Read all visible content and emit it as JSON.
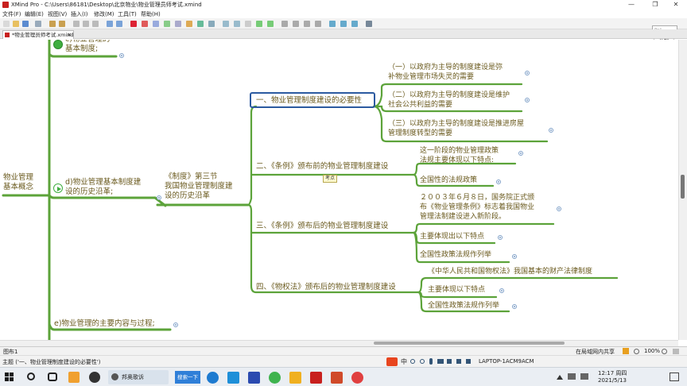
{
  "window": {
    "title": "XMind Pro - C:\\Users\\86181\\Desktop\\北京物业\\物业管理员师考试.xmind",
    "min": "—",
    "max": "❐",
    "close": "✕"
  },
  "menu": [
    "文件(F)",
    "编辑(E)",
    "视图(V)",
    "插入(I)",
    "修改(M)",
    "工具(T)",
    "帮助(H)"
  ],
  "tab": {
    "label": "*物业管理员师考试.xmind",
    "close": "✕"
  },
  "popup": {
    "hint": "Pol...",
    "button": "开始"
  },
  "mindmap": {
    "root": "物业管理\n基本概念",
    "top_topic": "c)物业管理的\n基本制度;",
    "d_topic": "d)物业管理基本制度建\n设的历史沿革;",
    "e_topic": "e)物业管理的主要内容与过程;",
    "section": "《制度》第三节\n我国物业管理制度建\n设的历史沿革",
    "marker": "考点",
    "branches": [
      {
        "label": "一、物业管理制度建设的必要性",
        "children": [
          "（一）以政府为主导的制度建设是弥\n补物业管理市场失灵的需要",
          "（二）以政府为主导的制度建设是维护\n社会公共利益的需要",
          "（三）以政府为主导的制度建设是推进房屋\n管理制度转型的需要"
        ]
      },
      {
        "label": "二、《条例》颁布前的物业管理制度建设",
        "children": [
          "这一阶段的物业管理政策\n法规主要体现以下特点:",
          "全国性的法规政策"
        ]
      },
      {
        "label": "三、《条例》颁布后的物业管理制度建设",
        "children": [
          "２００３年６月８日，国务院正式颁\n布《物业管理条例》标志着我国物业\n管理法制建设进入新阶段。",
          "主要体现出以下特点",
          "全国性政策法规作列举"
        ]
      },
      {
        "label": "四、《物权法》颁布后的物业管理制度建设",
        "children": [
          "《中华人民共和国物权法》我国基本的财产法律制度",
          "主要体现以下特点",
          "全国性政策法规作列举"
        ]
      }
    ]
  },
  "sheet": {
    "label": "图布1"
  },
  "status": {
    "topic": "主题 ('一、物业管理制度建设的必要性')",
    "share": "在局域网内共享",
    "zoom": "100%",
    "computer": "LAPTOP-1ACM9ACM",
    "ime": "中"
  },
  "taskbar": {
    "task_label": "邦奥歌诉",
    "search_label": "搜索一下",
    "time": "12:17 周四",
    "date": "2021/5/13"
  },
  "colors": {
    "branch": "#5ca33a",
    "text": "#6a5a1e",
    "selection": "#2c5aa0",
    "accent": "#c8201e"
  }
}
